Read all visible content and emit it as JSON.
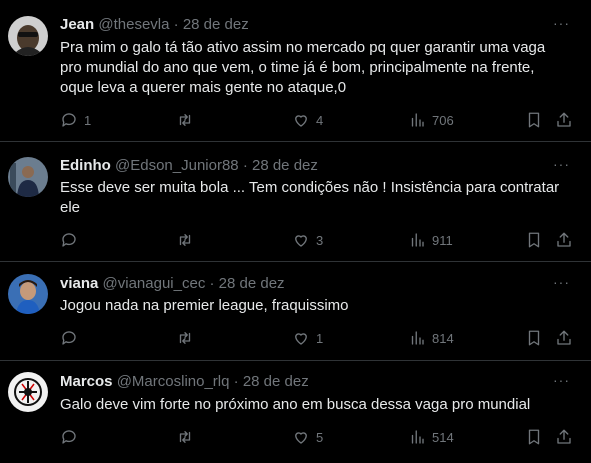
{
  "colors": {
    "background": "#000000",
    "text": "#e7e9ea",
    "muted": "#71767b",
    "divider": "#2f3336"
  },
  "icons": {
    "reply": "speech-bubble-icon",
    "retweet": "retweet-arrows-icon",
    "like": "heart-icon",
    "views": "bar-chart-icon",
    "bookmark": "bookmark-icon",
    "share": "share-arrow-icon",
    "more": "three-dots-icon"
  },
  "tweets": [
    {
      "name": "Jean",
      "handle": "@thesevla",
      "separator": "·",
      "date": "28 de dez",
      "more": "···",
      "text": "Pra mim o galo tá tão ativo assim no mercado pq quer garantir uma vaga\npro mundial do ano que vem, o time já é bom, principalmente na frente,\noque leva a querer mais gente no ataque,0",
      "replies": "1",
      "retweets": "",
      "likes": "4",
      "views": "706"
    },
    {
      "name": "Edinho",
      "handle": "@Edson_Junior88",
      "separator": "·",
      "date": "28 de dez",
      "more": "···",
      "text": "Esse deve ser muita bola ... Tem condições não ! Insistência para contratar\nele",
      "replies": "",
      "retweets": "",
      "likes": "3",
      "views": "911"
    },
    {
      "name": "viana",
      "handle": "@vianagui_cec",
      "separator": "·",
      "date": "28 de dez",
      "more": "···",
      "text": "Jogou nada na premier league, fraquissimo",
      "replies": "",
      "retweets": "",
      "likes": "1",
      "views": "814"
    },
    {
      "name": "Marcos",
      "handle": "@Marcoslino_rlq",
      "separator": "·",
      "date": "28 de dez",
      "more": "···",
      "text": "Galo deve vim forte no próximo ano em busca dessa vaga pro mundial",
      "replies": "",
      "retweets": "",
      "likes": "5",
      "views": "514"
    }
  ]
}
